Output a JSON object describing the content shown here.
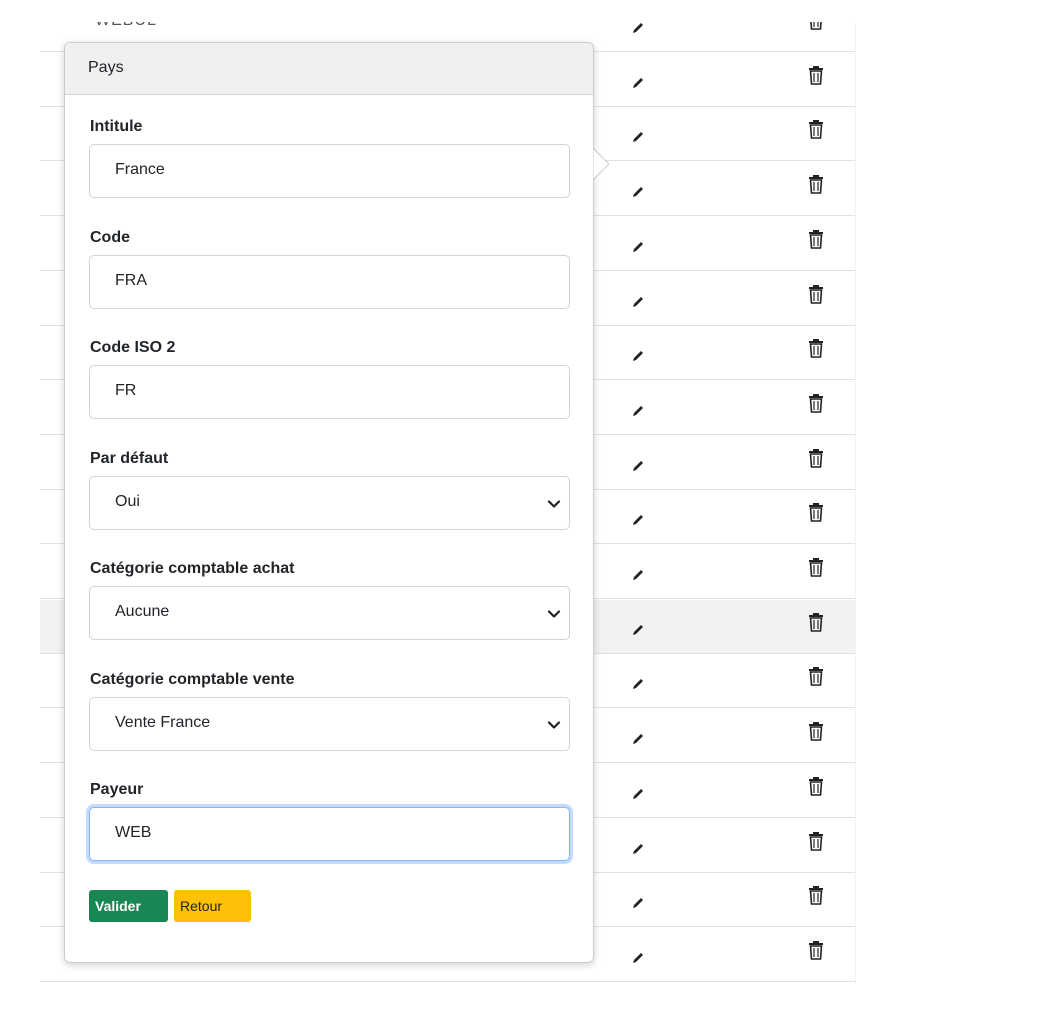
{
  "background_table": {
    "partial_top_text": "WEBUL",
    "row_count": 17,
    "highlighted_row_index": 10,
    "edit_icon": "pencil-icon",
    "delete_icon": "trash-icon"
  },
  "popover": {
    "title": "Pays",
    "fields": [
      {
        "label": "Intitule",
        "value": "France",
        "type": "text"
      },
      {
        "label": "Code",
        "value": "FRA",
        "type": "text"
      },
      {
        "label": "Code ISO 2",
        "value": "FR",
        "type": "text"
      },
      {
        "label": "Par défaut",
        "value": "Oui",
        "type": "select"
      },
      {
        "label": "Catégorie comptable achat",
        "value": "Aucune",
        "type": "select"
      },
      {
        "label": "Catégorie comptable vente",
        "value": "Vente France",
        "type": "select"
      },
      {
        "label": "Payeur",
        "value": "WEB",
        "type": "text",
        "focused": true
      }
    ],
    "buttons": {
      "submit": "Valider",
      "back": "Retour"
    }
  },
  "colors": {
    "submit_bg": "#198754",
    "back_bg": "#ffc107",
    "focus_border": "#86b7fe"
  }
}
